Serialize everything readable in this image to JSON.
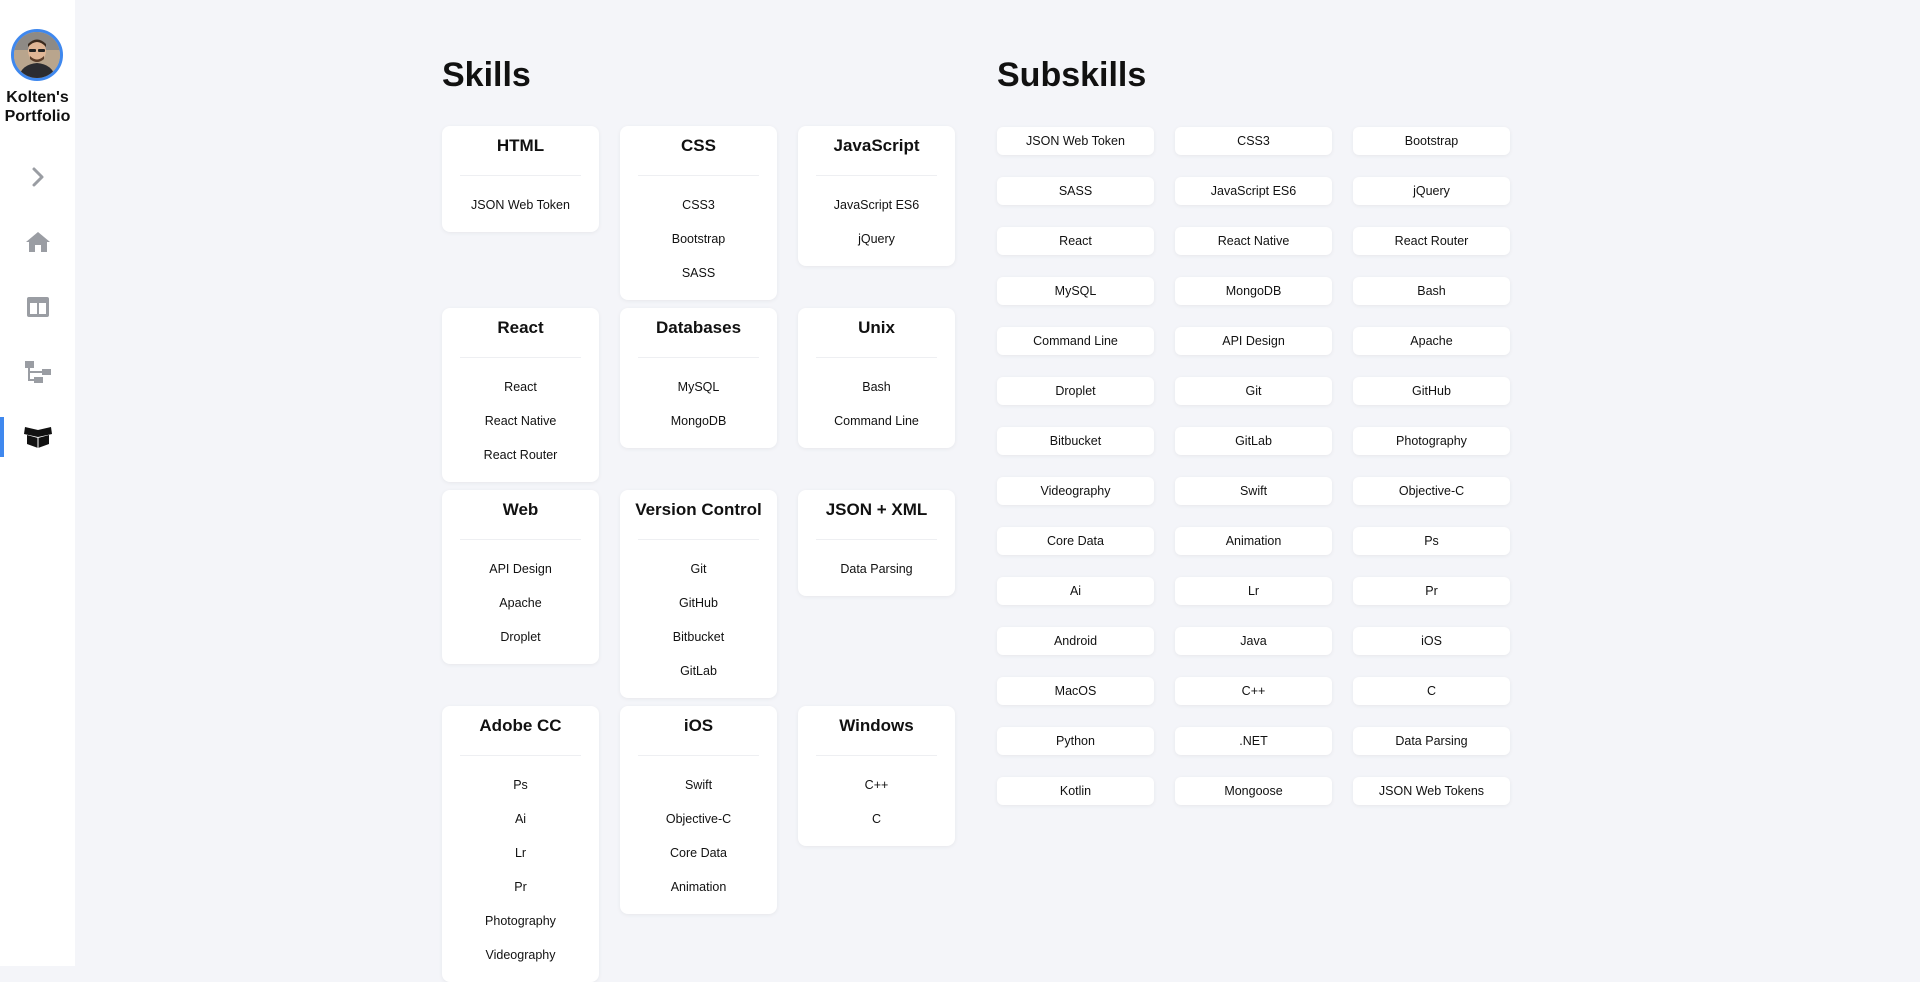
{
  "sidebar": {
    "brand_line1": "Kolten's",
    "brand_line2": "Portfolio",
    "nav": [
      {
        "icon": "chevron-right-icon"
      },
      {
        "icon": "home-icon"
      },
      {
        "icon": "layout-icon"
      },
      {
        "icon": "sitemap-icon"
      },
      {
        "icon": "open-box-icon",
        "active": true
      }
    ],
    "accent_color": "#3f88ee"
  },
  "skills": {
    "title": "Skills",
    "cards": [
      {
        "title": "HTML",
        "items": [
          "JSON Web Token"
        ]
      },
      {
        "title": "CSS",
        "items": [
          "CSS3",
          "Bootstrap",
          "SASS"
        ]
      },
      {
        "title": "JavaScript",
        "items": [
          "JavaScript ES6",
          "jQuery"
        ]
      },
      {
        "title": "React",
        "items": [
          "React",
          "React Native",
          "React Router"
        ]
      },
      {
        "title": "Databases",
        "items": [
          "MySQL",
          "MongoDB"
        ]
      },
      {
        "title": "Unix",
        "items": [
          "Bash",
          "Command Line"
        ]
      },
      {
        "title": "Web",
        "items": [
          "API Design",
          "Apache",
          "Droplet"
        ]
      },
      {
        "title": "Version Control",
        "items": [
          "Git",
          "GitHub",
          "Bitbucket",
          "GitLab"
        ]
      },
      {
        "title": "JSON + XML",
        "items": [
          "Data Parsing"
        ]
      },
      {
        "title": "Adobe CC",
        "items": [
          "Ps",
          "Ai",
          "Lr",
          "Pr",
          "Photography",
          "Videography"
        ]
      },
      {
        "title": "iOS",
        "items": [
          "Swift",
          "Objective-C",
          "Core Data",
          "Animation"
        ]
      },
      {
        "title": "Windows",
        "items": [
          "C++",
          "C"
        ]
      }
    ]
  },
  "subskills": {
    "title": "Subskills",
    "items": [
      "JSON Web Token",
      "CSS3",
      "Bootstrap",
      "SASS",
      "JavaScript ES6",
      "jQuery",
      "React",
      "React Native",
      "React Router",
      "MySQL",
      "MongoDB",
      "Bash",
      "Command Line",
      "API Design",
      "Apache",
      "Droplet",
      "Git",
      "GitHub",
      "Bitbucket",
      "GitLab",
      "Photography",
      "Videography",
      "Swift",
      "Objective-C",
      "Core Data",
      "Animation",
      "Ps",
      "Ai",
      "Lr",
      "Pr",
      "Android",
      "Java",
      "iOS",
      "MacOS",
      "C++",
      "C",
      "Python",
      ".NET",
      "Data Parsing",
      "Kotlin",
      "Mongoose",
      "JSON Web Tokens"
    ]
  }
}
